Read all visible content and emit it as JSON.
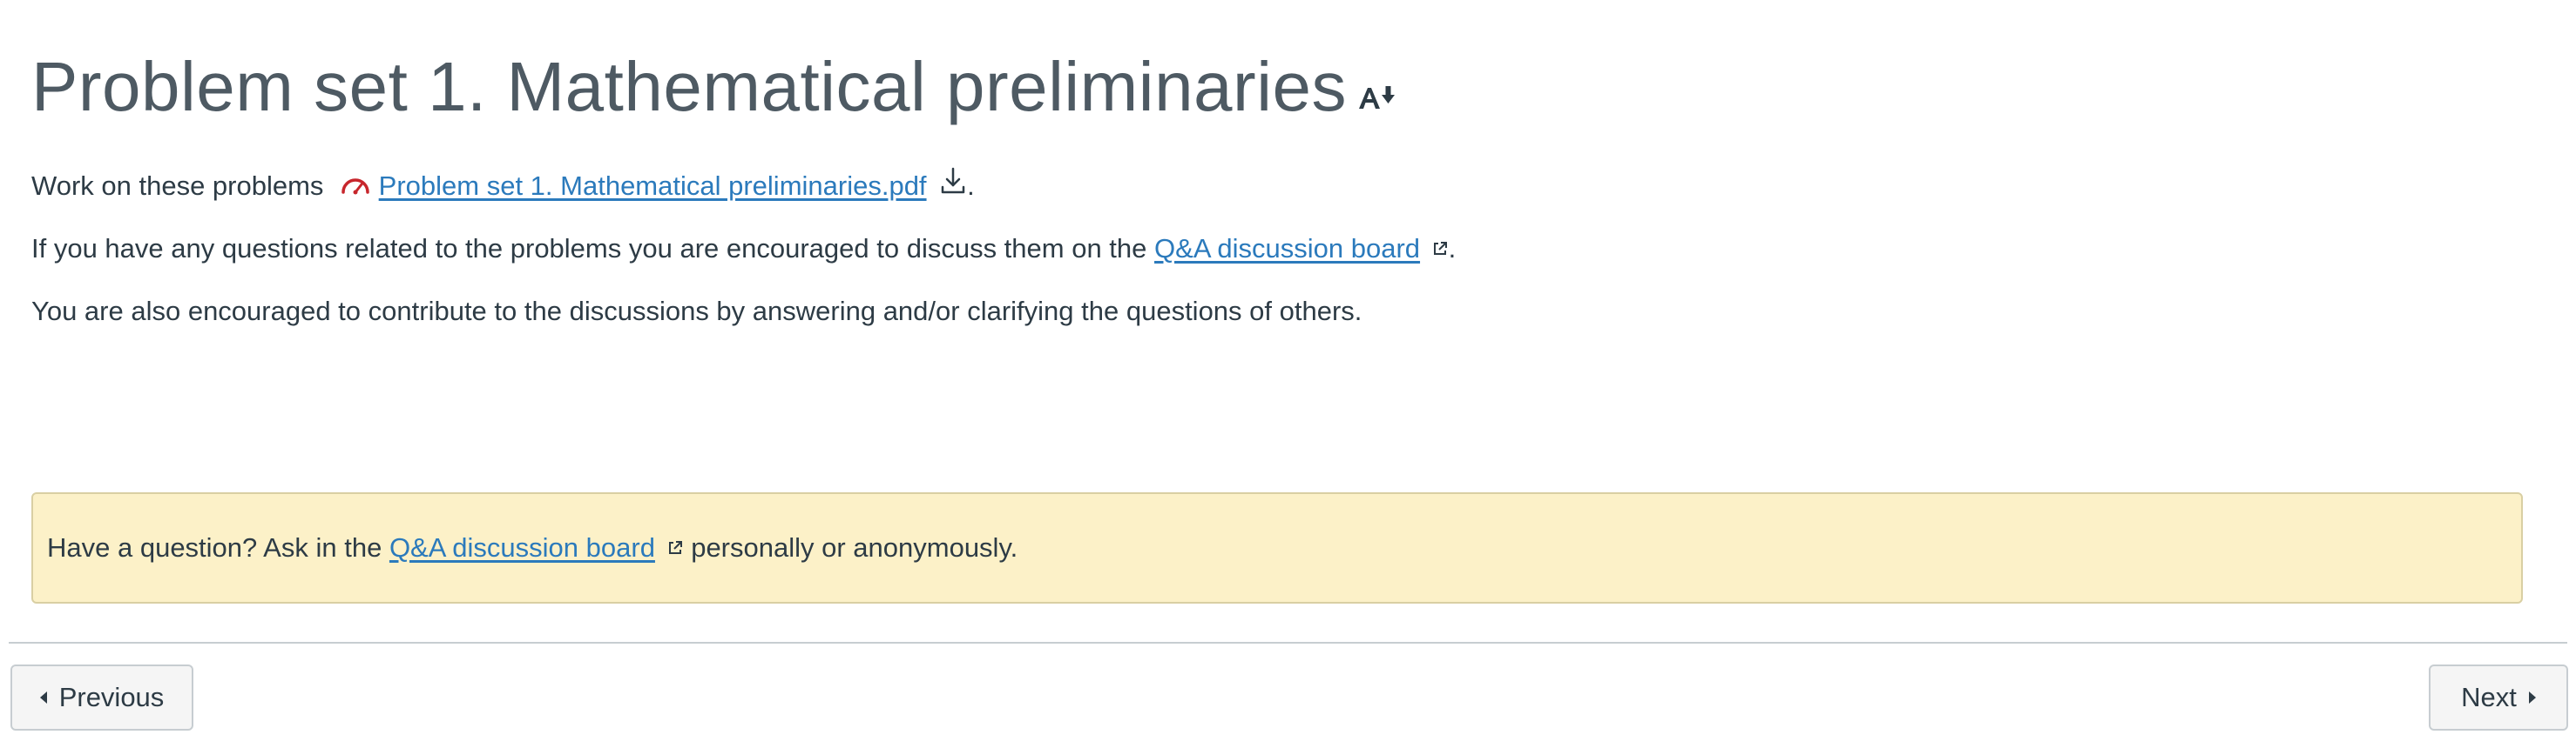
{
  "page": {
    "title": "Problem set 1. Mathematical preliminaries",
    "title_icon": "accessibility-font-icon"
  },
  "content": {
    "para1": {
      "prefix": "Work on these problems",
      "file_link": "Problem set 1. Mathematical preliminaries.pdf",
      "file_icon": "gauge-icon",
      "download_icon": "download-icon",
      "suffix": "."
    },
    "para2": {
      "prefix": "If you have any questions related to the problems you are encouraged to discuss them on the",
      "link": "Q&A discussion board",
      "link_icon": "external-link-icon",
      "suffix": "."
    },
    "para3": {
      "text": "You are also encouraged to contribute to the discussions by answering and/or clarifying the questions of others."
    }
  },
  "notice": {
    "prefix": "Have a question? Ask in the",
    "link": "Q&A discussion board",
    "link_icon": "external-link-icon",
    "suffix": "personally or anonymously."
  },
  "navigation": {
    "previous_label": "Previous",
    "next_label": "Next"
  },
  "colors": {
    "link": "#2b7abc",
    "notice_bg": "#fcf1c8",
    "text": "#2d3b45",
    "gauge_icon": "#c7262c"
  }
}
